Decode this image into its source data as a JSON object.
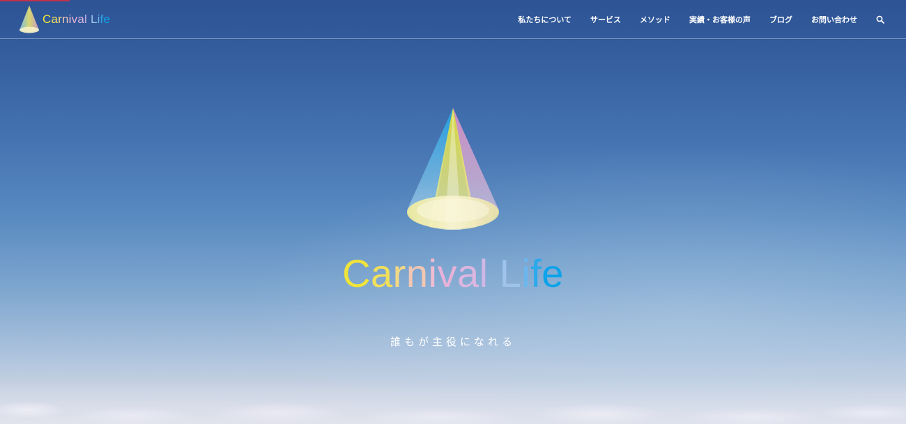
{
  "header": {
    "logo_text_parts": [
      "C",
      "a",
      "r",
      "n",
      "i",
      "v",
      "a",
      "l",
      " ",
      "L",
      "i",
      "f",
      "e"
    ],
    "nav": [
      {
        "label": "私たちについて"
      },
      {
        "label": "サービス"
      },
      {
        "label": "メソッド"
      },
      {
        "label": "実績・お客様の声"
      },
      {
        "label": "ブログ"
      },
      {
        "label": "お問い合わせ"
      }
    ],
    "search_icon": "search-icon"
  },
  "hero": {
    "title_parts": [
      "C",
      "a",
      "r",
      "n",
      "i",
      "v",
      "a",
      "l",
      " ",
      "L",
      "i",
      "f",
      "e"
    ],
    "tagline": "誰もが主役になれる"
  },
  "colors": {
    "title_letters": [
      "#f0e43a",
      "#f2df5a",
      "#f3d884",
      "#f2c7b2",
      "#efbcd0",
      "#e6b2d8",
      "#dcb6e0",
      "#cfb7e6",
      "",
      "#9fc3ea",
      "#6ab6ee",
      "#2aa9ec",
      "#0aa3ea"
    ],
    "accent_bar": "#c2304a",
    "sky_top": "#2d5395",
    "sky_bottom": "#dcdfe9"
  }
}
